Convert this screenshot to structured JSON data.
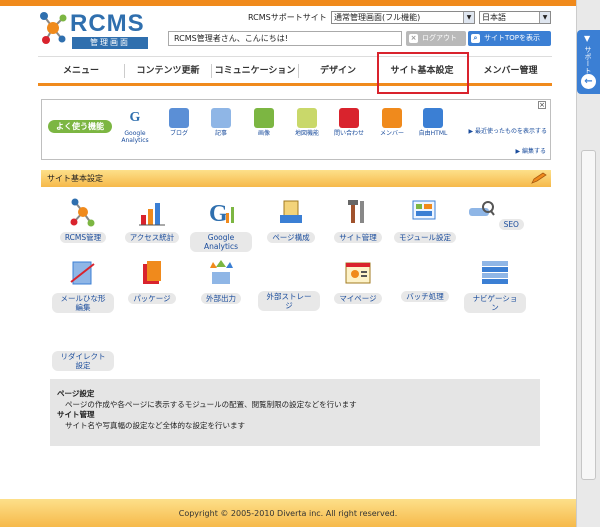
{
  "brand": {
    "name": "RCMS",
    "sub": "管理画面"
  },
  "header": {
    "support_label": "RCMSサポートサイト",
    "mode_select": "通常管理画面(フル機能)",
    "lang_select": "日本語",
    "greeting": "RCMS管理者さん、こんにちは!",
    "logout_label": "ログアウト",
    "site_top_label": "サイトTOPを表示"
  },
  "nav": [
    "メニュー",
    "コンテンツ更新",
    "コミュニケーション",
    "デザイン",
    "サイト基本設定",
    "メンバー管理"
  ],
  "favorites": {
    "label": "よく使う機能",
    "close": "×",
    "items": [
      "Google Analytics",
      "ブログ",
      "記事",
      "画像",
      "地図機能",
      "問い合わせ",
      "メンバー",
      "自由HTML"
    ],
    "link_recent": "最近使ったものを表示する",
    "link_edit": "編集する"
  },
  "section": {
    "title": "サイト基本設定",
    "items": [
      "RCMS管理",
      "アクセス統計",
      "Google Analytics",
      "ページ構成",
      "サイト管理",
      "モジュール設定",
      "SEO",
      "メールひな形編集",
      "パッケージ",
      "外部出力",
      "外部ストレージ",
      "マイページ",
      "バッチ処理",
      "ナビゲーション",
      "リダイレクト設定"
    ]
  },
  "description": {
    "h1": "ページ設定",
    "b1": "ページの作成や各ページに表示するモジュールの配置、閲覧制限の設定などを行います",
    "h2": "サイト管理",
    "b2": "サイト名や写真幅の設定など全体的な設定を行います"
  },
  "side_tab": {
    "label": "サポート"
  },
  "footer": {
    "copyright": "Copyright © 2005-2010 Diverta inc. All right reserved."
  },
  "colors": {
    "accent": "#f08a1c",
    "brand": "#2f6fae",
    "link": "#1a4c9c",
    "highlight": "#d9232d"
  }
}
